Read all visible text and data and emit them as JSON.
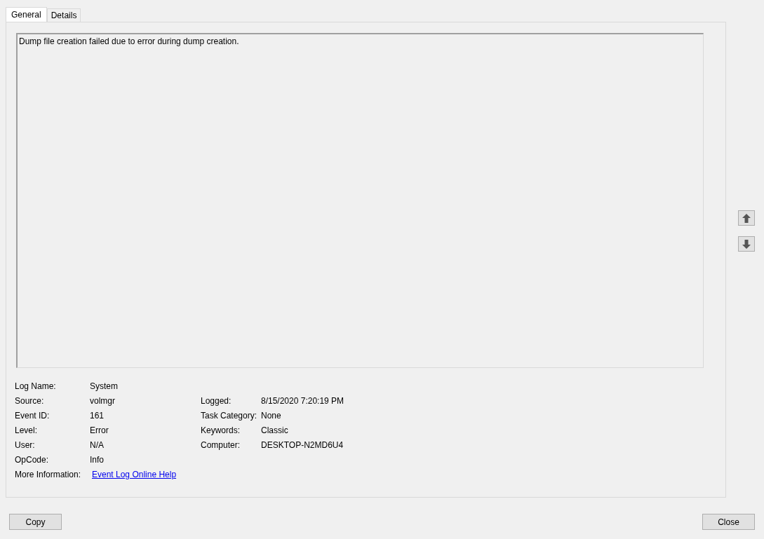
{
  "tabs": [
    {
      "label": "General",
      "selected": true
    },
    {
      "label": "Details",
      "selected": false
    }
  ],
  "message": "Dump file creation failed due to error during dump creation.",
  "properties_left": [
    {
      "label": "Log Name:",
      "value": "System",
      "kind": "text"
    },
    {
      "label": "Source:",
      "value": "volmgr",
      "kind": "text"
    },
    {
      "label": "Event ID:",
      "value": "161",
      "kind": "text"
    },
    {
      "label": "Level:",
      "value": "Error",
      "kind": "text"
    },
    {
      "label": "User:",
      "value": "N/A",
      "kind": "text"
    },
    {
      "label": "OpCode:",
      "value": "Info",
      "kind": "text"
    },
    {
      "label": "More Information:",
      "value": "Event Log Online Help",
      "kind": "link"
    }
  ],
  "properties_right": [
    {
      "label": "Logged:",
      "value": "8/15/2020 7:20:19 PM"
    },
    {
      "label": "Task Category:",
      "value": "None"
    },
    {
      "label": "Keywords:",
      "value": "Classic"
    },
    {
      "label": "Computer:",
      "value": "DESKTOP-N2MD6U4"
    }
  ],
  "buttons": {
    "left": "Copy",
    "right": "Close"
  }
}
